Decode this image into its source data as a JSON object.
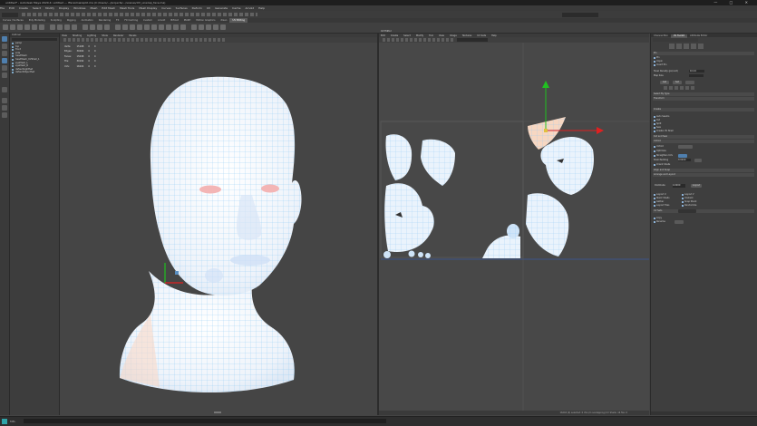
{
  "window": {
    "title": "untitled* - Autodesk Maya 2020.4: untitled  ---  ffaceUnwrapUI.ma (C:/Users/.../projects/.../scenes/UV_unwrap_face.ma)",
    "controls": "— □ ✕"
  },
  "menubar": [
    "File",
    "Edit",
    "Create",
    "Select",
    "Modify",
    "Display",
    "Windows",
    "Mesh",
    "Edit Mesh",
    "Mesh Tools",
    "Mesh Display",
    "Curves",
    "Surfaces",
    "Deform",
    "UV",
    "Generate",
    "Cache",
    "Arnold",
    "Help"
  ],
  "shelf_tabs": {
    "items": [
      "Curves / Surfaces",
      "Poly Modeling",
      "Sculpting",
      "Rigging",
      "Animation",
      "Rendering",
      "FX",
      "FX Caching",
      "Custom",
      "Arnold",
      "Bifrost",
      "MASH",
      "Motion Graphics",
      "XGen",
      "UV Editing"
    ],
    "active": "UV Editing"
  },
  "outliner": {
    "title": "Outliner",
    "items": [
      "persp",
      "top",
      "front",
      "side",
      "headMesh",
      "headMesh_UVShell_1",
      "eyeMesh_L",
      "eyeMesh_R",
      "defaultLightSet",
      "defaultObjectSet"
    ]
  },
  "viewport": {
    "menu": [
      "View",
      "Shading",
      "Lighting",
      "Show",
      "Renderer",
      "Panels"
    ],
    "hud": [
      [
        "Verts:",
        "15168",
        "0",
        "0"
      ],
      [
        "Edges:",
        "30264",
        "0",
        "0"
      ],
      [
        "Faces:",
        "15098",
        "0",
        "0"
      ],
      [
        "Tris:",
        "30192",
        "0",
        "0"
      ],
      [
        "UVs:",
        "16204",
        "0",
        "0"
      ]
    ]
  },
  "uv_editor": {
    "title": "UV Editor",
    "menu": [
      "Edit",
      "Create",
      "Select",
      "Modify",
      "Tool",
      "View",
      "Image",
      "Textures",
      "UV Sets",
      "Help"
    ],
    "footer_info": "16204 (0) selected: 0 UVs  (0 overlapping)  UV Shells: 16  Tex: 0"
  },
  "uv_toolkit": {
    "tabs": [
      "Channel Box",
      "UV Toolkit",
      "Attribute Editor"
    ],
    "active_tab": "UV Toolkit",
    "sections": [
      "Pin",
      "Select By Type",
      "Transform",
      "Create",
      "Cut and Sew",
      "Unfold",
      "Align and Snap",
      "Arrange and Layout",
      "UV Sets"
    ],
    "fields": {
      "shell_padding": "0.0200",
      "tile_padding": "0.0000",
      "texel_density": "10.24"
    },
    "buttons": [
      "Unfold",
      "Optimize",
      "Straighten UVs",
      "Layout",
      "Orient Shells",
      "Distribute",
      "Get",
      "Set"
    ],
    "checks": [
      "Pin",
      "Unpin",
      "Invert Pin",
      "Cut",
      "Split",
      "Sew",
      "Auto Seams",
      "Create UV Shell"
    ]
  },
  "command_line": {
    "label": "MEL"
  },
  "colors": {
    "accent": "#5a8fc2",
    "x_axis": "#e02020",
    "y_axis": "#20c020"
  }
}
